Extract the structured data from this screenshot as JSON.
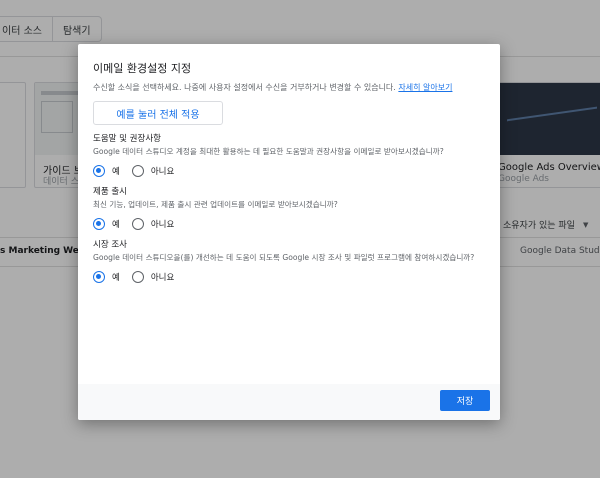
{
  "background": {
    "tabs": [
      {
        "label": "이터 소스"
      },
      {
        "label": "탐색기"
      }
    ],
    "cards": {
      "guide_title": "가이드 보",
      "guide_sub": "데이터 스",
      "ads_title": "Google Ads Overview",
      "ads_sub": "Google Ads"
    },
    "owner_filter": "소유자가 있는 파일",
    "rows": {
      "marketing": "s Marketing Website",
      "studio": "Google Data Studio"
    }
  },
  "dialog": {
    "title": "이메일 환경설정 지정",
    "description": "수신할 소식을 선택하세요. 나중에 사용자 설정에서 수신을 거부하거나 변경할 수 있습니다.",
    "learn_more": "자세히 알아보기",
    "apply_all_label": "예를 눌러 전체 적용",
    "sections": [
      {
        "title": "도움말 및 권장사항",
        "description": "Google 데이터 스튜디오 계정을 최대한 활용하는 데 필요한 도움말과 권장사항을 이메일로 받아보시겠습니까?",
        "yes": "예",
        "no": "아니요",
        "selected": "yes"
      },
      {
        "title": "제품 출시",
        "description": "최신 기능, 업데이트, 제품 출시 관련 업데이트를 이메일로 받아보시겠습니까?",
        "yes": "예",
        "no": "아니요",
        "selected": "yes"
      },
      {
        "title": "시장 조사",
        "description": "Google 데이터 스튜디오을(를) 개선하는 데 도움이 되도록 Google 시장 조사 및 파일럿 프로그램에 참여하시겠습니까?",
        "yes": "예",
        "no": "아니요",
        "selected": "yes"
      }
    ],
    "save_label": "저장"
  },
  "colors": {
    "accent": "#1a73e8",
    "overlay": "rgba(0,0,0,0.32)"
  }
}
